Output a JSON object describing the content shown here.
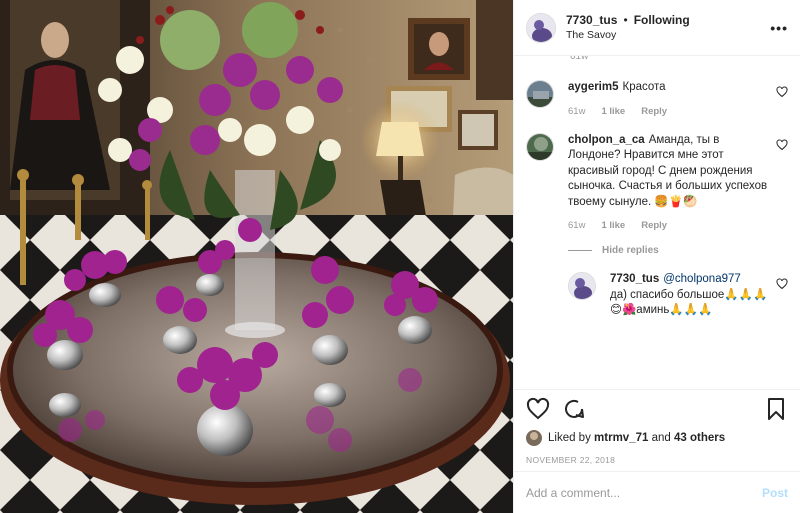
{
  "header": {
    "username": "7730_tus",
    "separator": "•",
    "follow_label": "Following",
    "location": "The Savoy",
    "more_icon": "more-horizontal-icon"
  },
  "cut_off_text": "61w",
  "comments": [
    {
      "username": "aygerim5",
      "text": "Красота",
      "time": "61w",
      "likes": "1 like",
      "reply_label": "Reply"
    },
    {
      "username": "cholpon_a_ca",
      "text": "Аманда, ты в Лондоне? Нравится мне этот красивый город! С днем рождения сыночка. Счастья и больших успехов твоему сынуле. 🍔🍟🥙",
      "time": "61w",
      "likes": "1 like",
      "reply_label": "Reply"
    }
  ],
  "hide_replies_label": "Hide replies",
  "reply": {
    "username": "7730_tus",
    "mention": "@cholpona977",
    "text": "да) спасибо большое🙏🙏🙏😊🌺аминь🙏🙏🙏"
  },
  "likes": {
    "prefix": "Liked by",
    "user": "mtrmv_71",
    "conj": "and",
    "others": "43 others"
  },
  "date": "NOVEMBER 22, 2018",
  "add_comment": {
    "placeholder": "Add a comment...",
    "post_label": "Post"
  },
  "colors": {
    "text": "#262626",
    "muted": "#999999",
    "post_disabled": "#b2dffc",
    "border": "#efefef"
  }
}
